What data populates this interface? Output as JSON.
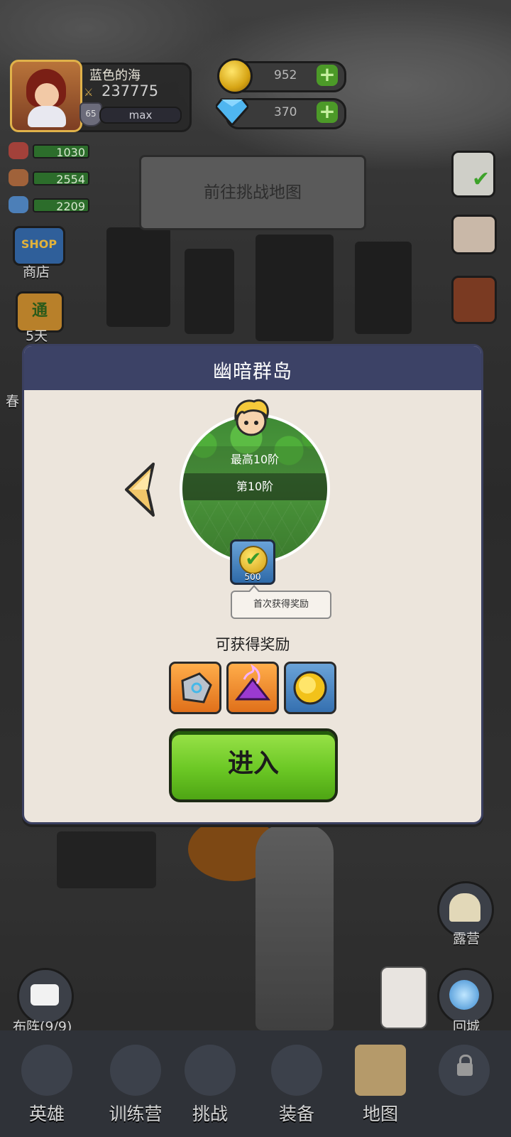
{
  "player": {
    "name": "蓝色的海",
    "power": "237775",
    "level": "65",
    "exp_label": "max"
  },
  "currency": {
    "gold": "952",
    "gems": "370"
  },
  "stats": [
    "1030",
    "2554",
    "2209"
  ],
  "header_button": "前往挑战地图",
  "side_left": {
    "shop_badge": "SHOP",
    "shop_label": "商店",
    "pass_badge": "通",
    "pass_label": "5天",
    "spring_label": "春"
  },
  "modal": {
    "title": "幽暗群岛",
    "max_stage": "最高10阶",
    "current_stage": "第10阶",
    "first_reward_amount": "500",
    "first_reward_tip": "首次获得奖励",
    "rewards_label": "可获得奖励",
    "enter_label": "进入"
  },
  "right_buttons": {
    "camp": "露营",
    "return_city": "回城"
  },
  "formation": "布阵(9/9)",
  "bottom_nav": [
    "英雄",
    "训练营",
    "挑战",
    "装备",
    "地图"
  ],
  "colors": {
    "modal_header": "#3c4266",
    "enter_button": "#6cc825",
    "modal_bg": "#ece5dc"
  }
}
